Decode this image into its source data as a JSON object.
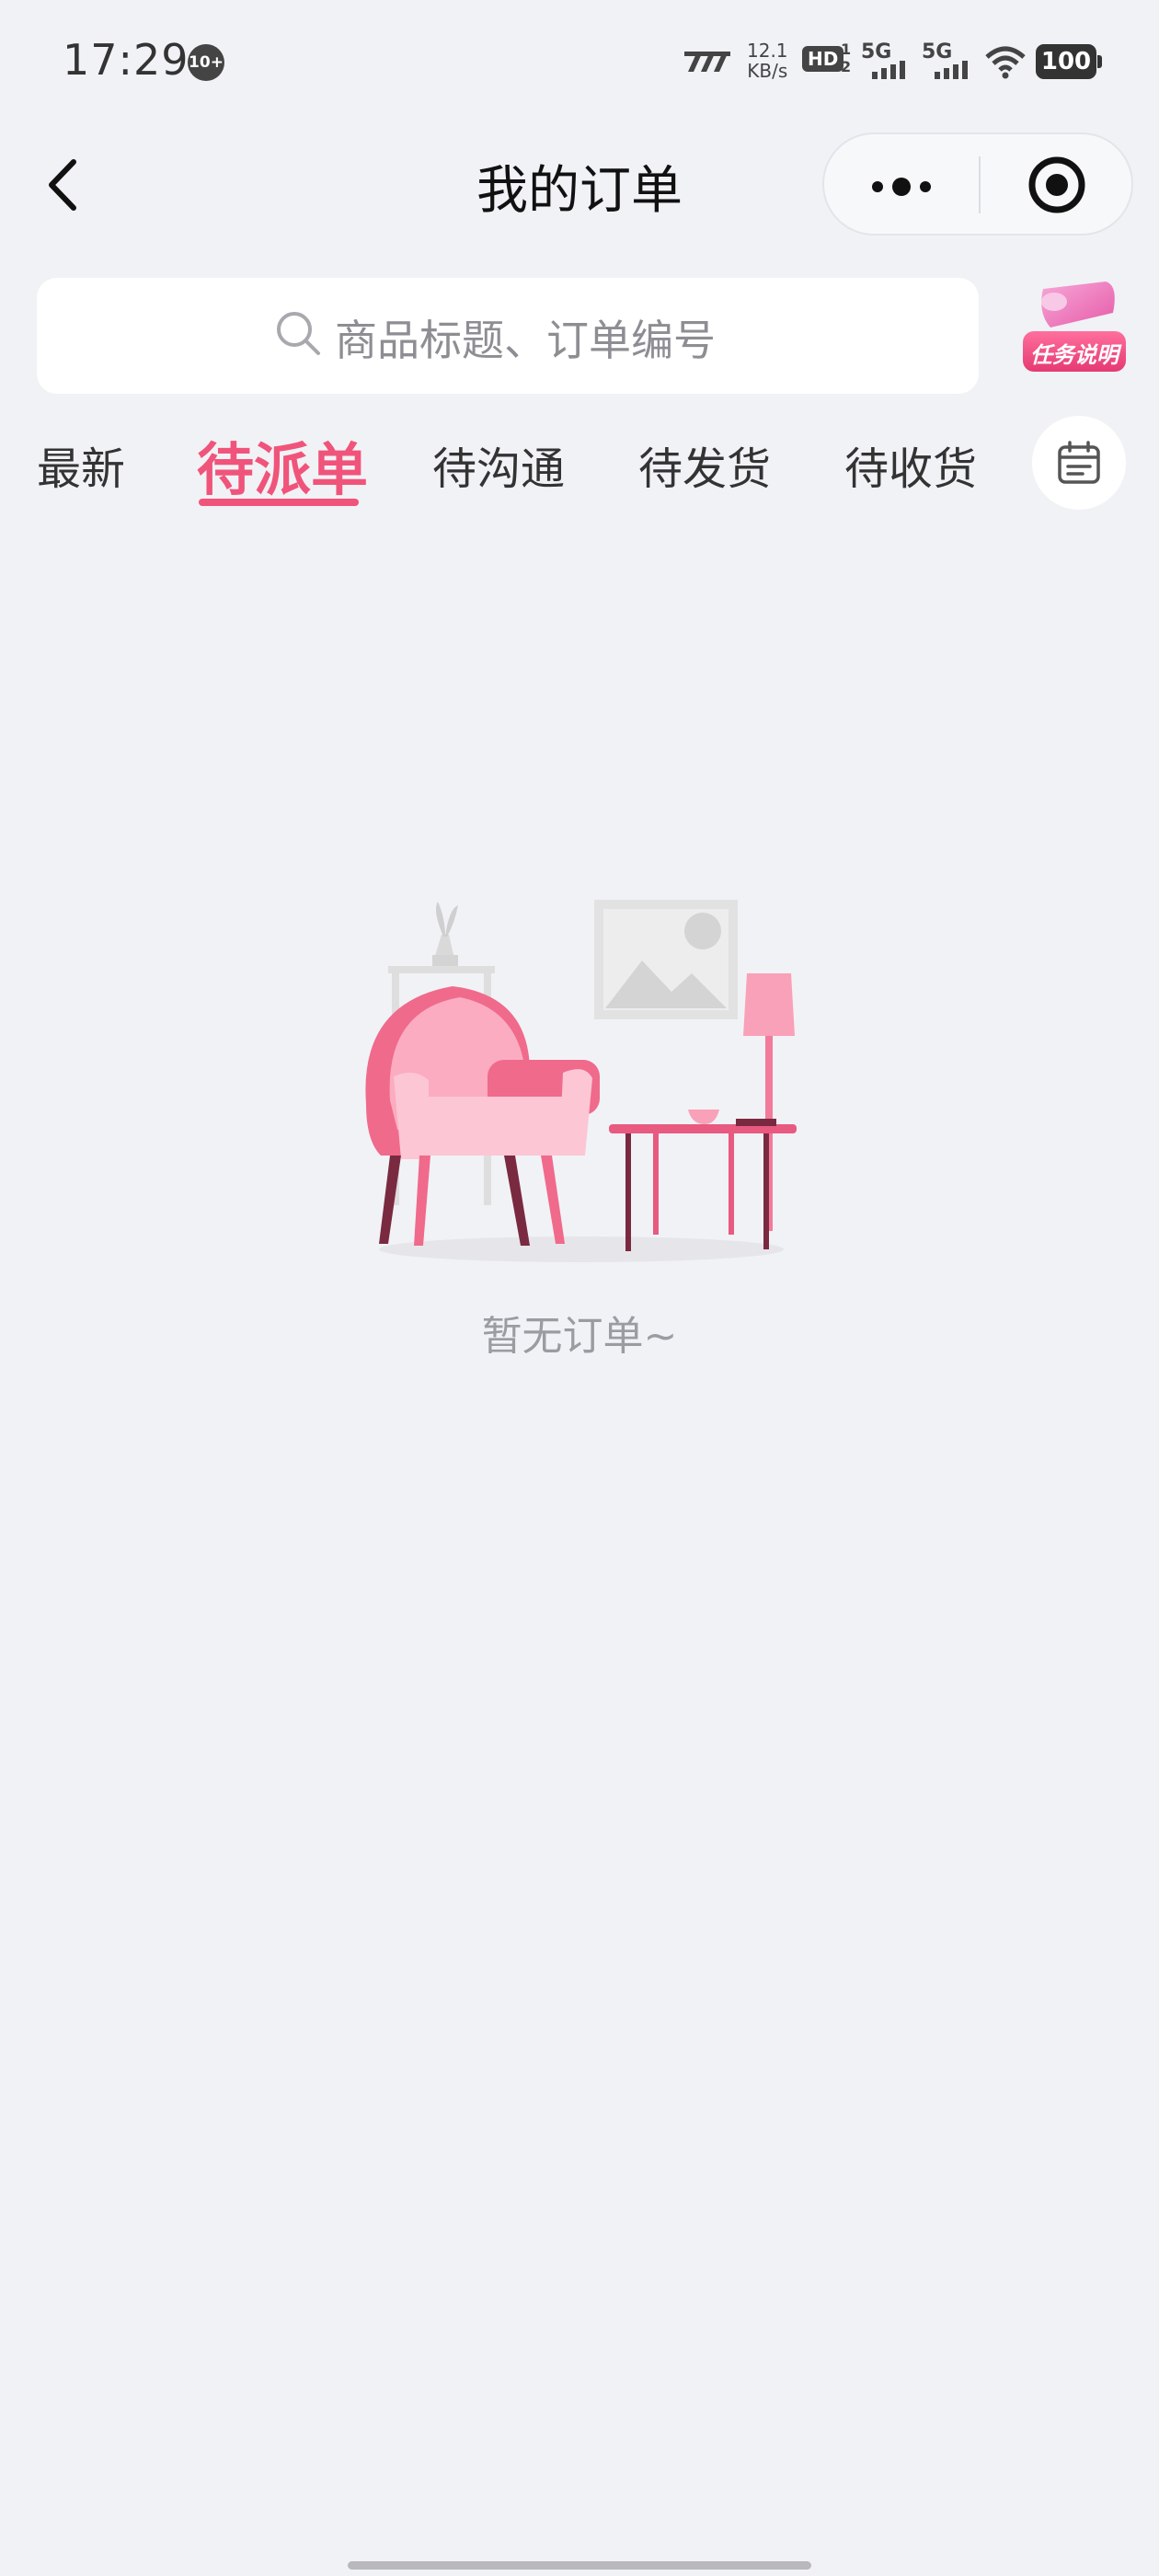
{
  "status_bar": {
    "time": "17:29",
    "notification_count": "10+",
    "network_speed_value": "12.1",
    "network_speed_unit": "KB/s",
    "hd_label": "HD",
    "sim1_label": "5G",
    "sim2_label": "5G",
    "battery": "100"
  },
  "nav": {
    "title": "我的订单",
    "back_icon": "chevron-left-icon",
    "more_icon": "more-dots-icon",
    "close_icon": "target-close-icon"
  },
  "search": {
    "placeholder": "商品标题、订单编号",
    "icon": "search-icon"
  },
  "task_badge": {
    "label": "任务说明"
  },
  "tabs": [
    {
      "label": "最新",
      "active": false
    },
    {
      "label": "待派单",
      "active": true
    },
    {
      "label": "待沟通",
      "active": false
    },
    {
      "label": "待发货",
      "active": false
    },
    {
      "label": "待收货",
      "active": false
    }
  ],
  "calendar_icon": "calendar-icon",
  "empty_state": {
    "message": "暂无订单~"
  },
  "colors": {
    "accent": "#f0547a",
    "background": "#f1f2f6"
  }
}
